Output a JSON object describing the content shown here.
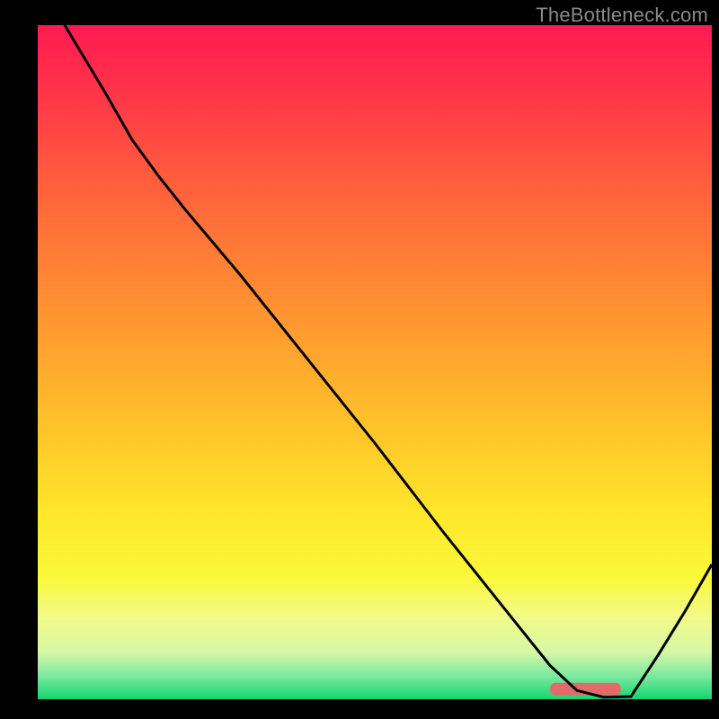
{
  "watermark": "TheBottleneck.com",
  "chart_data": {
    "type": "line",
    "title": "",
    "xlabel": "",
    "ylabel": "",
    "xlim": [
      0,
      100
    ],
    "ylim": [
      0,
      100
    ],
    "grid": false,
    "series": [
      {
        "name": "main-curve",
        "x": [
          4,
          10,
          14,
          18,
          22,
          30,
          40,
          50,
          60,
          70,
          76,
          80,
          84,
          88,
          92,
          96,
          100
        ],
        "values": [
          100,
          90,
          83,
          77.5,
          72.5,
          63,
          50.5,
          38,
          25,
          12.5,
          5,
          1.3,
          0.3,
          0.4,
          6.5,
          13,
          20
        ]
      }
    ],
    "highlight": {
      "x_start": 76,
      "x_end": 86.5,
      "y": 1.5,
      "color": "#e46a6a"
    },
    "gradient": {
      "stops": [
        {
          "offset": 0.0,
          "color": "#ff1a52"
        },
        {
          "offset": 0.1,
          "color": "#ff3548"
        },
        {
          "offset": 0.22,
          "color": "#ff5a3e"
        },
        {
          "offset": 0.35,
          "color": "#ff7f35"
        },
        {
          "offset": 0.48,
          "color": "#ffa22e"
        },
        {
          "offset": 0.6,
          "color": "#ffc42a"
        },
        {
          "offset": 0.72,
          "color": "#ffe629"
        },
        {
          "offset": 0.82,
          "color": "#faf83a"
        },
        {
          "offset": 0.88,
          "color": "#f2fa8a"
        },
        {
          "offset": 0.93,
          "color": "#d6f7a6"
        },
        {
          "offset": 0.965,
          "color": "#7ee9a0"
        },
        {
          "offset": 1.0,
          "color": "#12d66e"
        }
      ]
    },
    "background": "#000000"
  }
}
